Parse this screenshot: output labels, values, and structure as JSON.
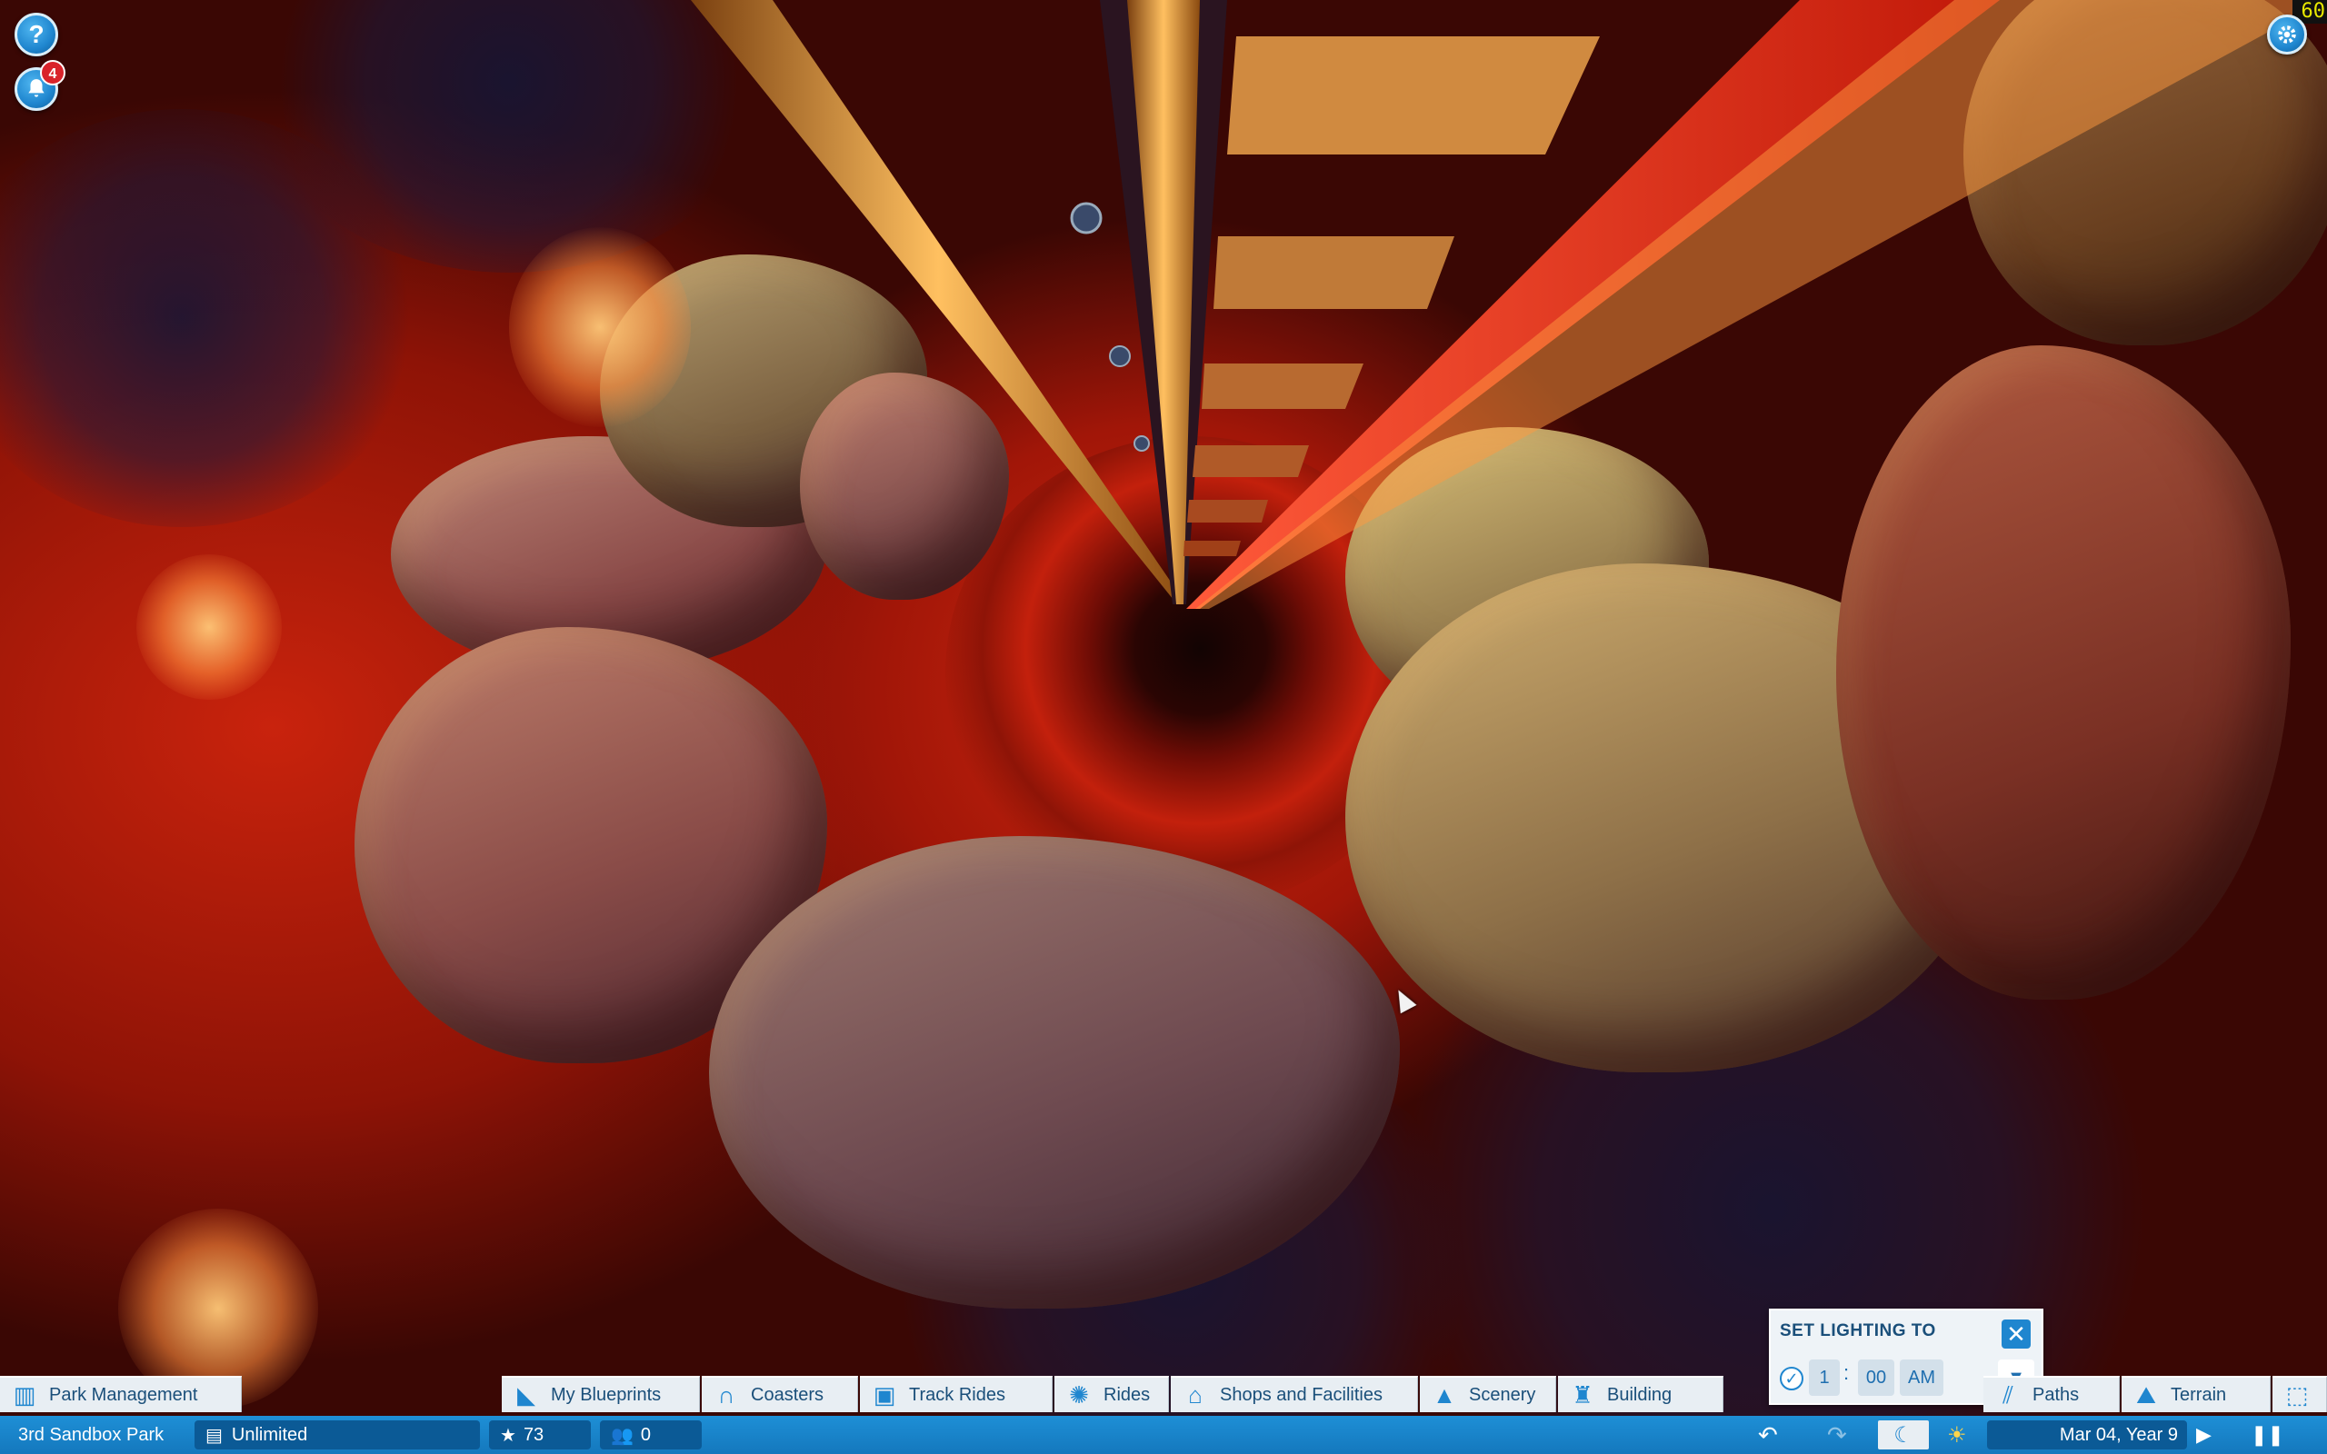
{
  "hud": {
    "help_icon": "question-mark",
    "notifications_count": "4",
    "fps": "60",
    "settings_icon": "gear"
  },
  "toolbar": {
    "park_management": "Park Management",
    "my_blueprints": "My Blueprints",
    "coasters": "Coasters",
    "track_rides": "Track Rides",
    "rides": "Rides",
    "shops_facilities": "Shops and Facilities",
    "scenery": "Scenery",
    "building": "Building",
    "paths": "Paths",
    "terrain": "Terrain"
  },
  "statusbar": {
    "park_name": "3rd Sandbox Park",
    "money": "Unlimited",
    "rating": "73",
    "guests": "0",
    "date": "Mar 04, Year 9"
  },
  "lighting_panel": {
    "title": "SET LIGHTING TO",
    "hour": "1",
    "separator": ":",
    "minute": "00",
    "ampm": "AM",
    "checked": true
  },
  "colors": {
    "accent": "#1f86cf",
    "statusbar": "#1478bd",
    "toolbar_bg": "#e8eef3",
    "lava": "#c9230d"
  }
}
